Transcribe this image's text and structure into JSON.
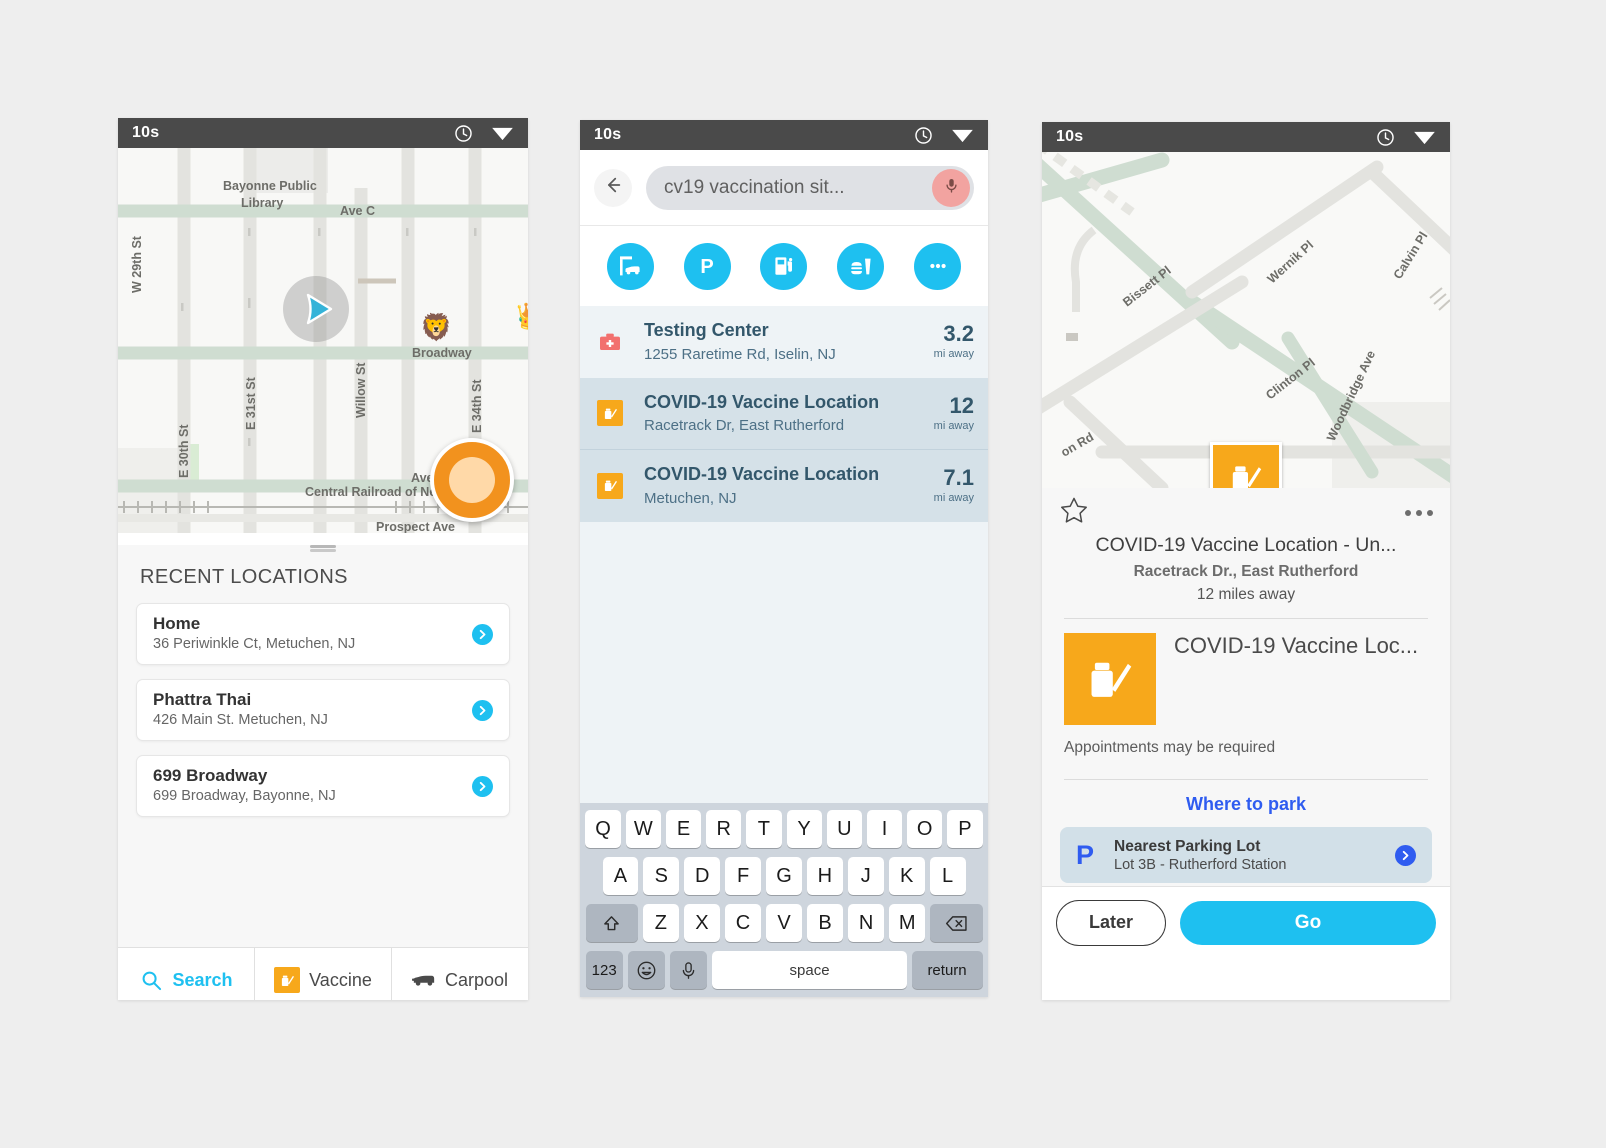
{
  "statusbar": {
    "time_label": "10s",
    "clock_icon": "clock-icon",
    "wifi_icon": "wifi-icon"
  },
  "phone1": {
    "map": {
      "labels": [
        "Bayonne Public Library",
        "Ave C",
        "W 29th St",
        "E 30th St",
        "E 31st St",
        "Willow St",
        "Broadway",
        "E 34th St",
        "Avenue",
        "Central Railroad of New Jersey",
        "Prospect Ave"
      ]
    },
    "sheet": {
      "title": "RECENT LOCATIONS",
      "items": [
        {
          "name": "Home",
          "address": "36 Periwinkle Ct, Metuchen, NJ"
        },
        {
          "name": "Phattra Thai",
          "address": "426 Main St. Metuchen, NJ"
        },
        {
          "name": "699 Broadway",
          "address": "699 Broadway, Bayonne, NJ"
        }
      ]
    },
    "tabs": [
      {
        "label": "Search",
        "icon": "search-icon",
        "active": true
      },
      {
        "label": "Vaccine",
        "icon": "vaccine-icon",
        "active": false
      },
      {
        "label": "Carpool",
        "icon": "car-icon",
        "active": false
      }
    ]
  },
  "phone2": {
    "search": {
      "back_icon": "arrow-left-icon",
      "query": "cv19 vaccination sit...",
      "mic_icon": "microphone-icon"
    },
    "categories": [
      {
        "name": "drive-thru-icon"
      },
      {
        "name": "parking-icon"
      },
      {
        "name": "gas-station-icon"
      },
      {
        "name": "food-icon"
      },
      {
        "name": "more-icon"
      }
    ],
    "results": [
      {
        "name": "Testing Center",
        "address": "1255 Raretime Rd, Iselin, NJ",
        "distance": "3.2",
        "unit": "mi away",
        "icon": "medical-kit-icon"
      },
      {
        "name": "COVID-19 Vaccine Location",
        "address": "Racetrack Dr, East Rutherford",
        "distance": "12",
        "unit": "mi away",
        "icon": "vaccine-icon"
      },
      {
        "name": "COVID-19 Vaccine Location",
        "address": "Metuchen, NJ",
        "distance": "7.1",
        "unit": "mi away",
        "icon": "vaccine-icon"
      }
    ],
    "keyboard": {
      "row1": [
        "Q",
        "W",
        "E",
        "R",
        "T",
        "Y",
        "U",
        "I",
        "O",
        "P"
      ],
      "row2": [
        "A",
        "S",
        "D",
        "F",
        "G",
        "H",
        "J",
        "K",
        "L"
      ],
      "row3": [
        "Z",
        "X",
        "C",
        "V",
        "B",
        "N",
        "M"
      ],
      "shift_icon": "shift-icon",
      "backspace_icon": "backspace-icon",
      "numeric_label": "123",
      "emoji_icon": "emoji-icon",
      "mic_icon": "microphone-icon",
      "space_label": "space",
      "return_label": "return"
    }
  },
  "phone3": {
    "map": {
      "labels": [
        "Bissett Pl",
        "Wernik Pl",
        "Calvin Pl",
        "Clinton Pl",
        "Woodbridge Ave",
        "on Rd"
      ],
      "marker_icon": "vaccine-icon"
    },
    "detail": {
      "favorite_icon": "star-icon",
      "overflow_icon": "more-horizontal-icon",
      "title": "COVID-19 Vaccine Location - Un...",
      "subtitle": "Racetrack Dr., East Rutherford",
      "distance": "12 miles away",
      "promo_title": "COVID-19 Vaccine Loc...",
      "promo_icon": "vaccine-icon",
      "note": "Appointments may be required",
      "park_heading": "Where to park",
      "parking": {
        "badge": "P",
        "name": "Nearest Parking Lot",
        "sub": "Lot 3B - Rutherford Station",
        "chevron_icon": "chevron-right-icon"
      },
      "actions": {
        "later_label": "Later",
        "go_label": "Go"
      }
    }
  },
  "colors": {
    "accent_cyan": "#1ec0f0",
    "vaccine_orange": "#f7a81b",
    "parking_blue": "#2f5cf0",
    "statusbar": "#4a4a4a",
    "result_dark": "#d5e1e8",
    "result_light": "#eef3f6"
  }
}
